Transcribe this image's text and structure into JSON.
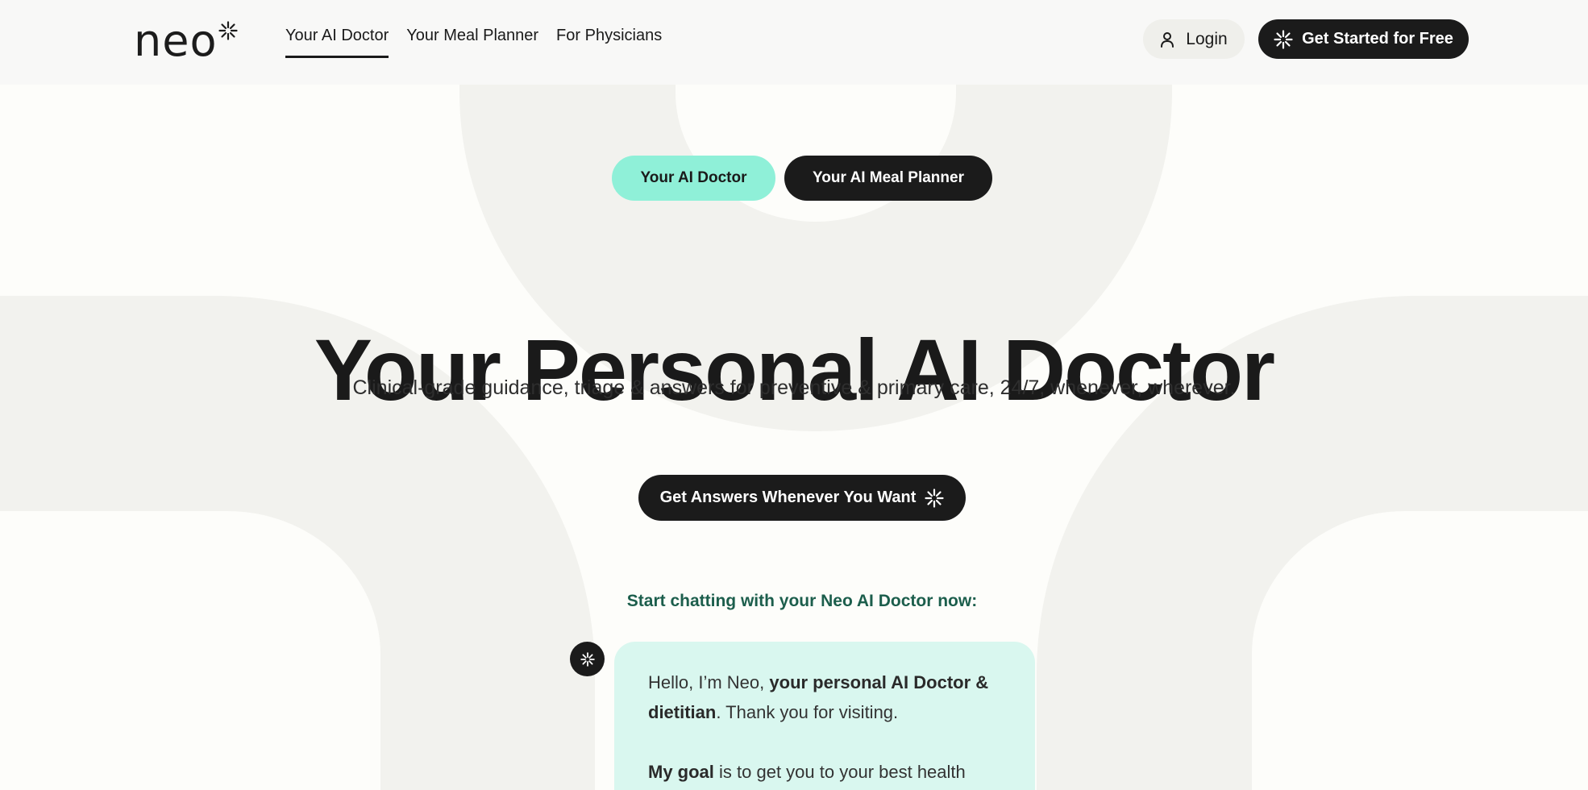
{
  "brand": {
    "logo_text": "neo",
    "colors": {
      "dark": "#1b1b1b",
      "mint": "#8ff0d8",
      "mint_light": "#d9f7ef",
      "green_text": "#1c5e4c",
      "bg_shape": "#f2f2ee"
    }
  },
  "nav": {
    "items": [
      {
        "label": "Your AI Doctor",
        "active": true
      },
      {
        "label": "Your Meal Planner",
        "active": false
      },
      {
        "label": "For Physicians",
        "active": false
      }
    ]
  },
  "header": {
    "login_label": "Login",
    "login_icon": "user-icon",
    "cta_label": "Get Started for Free",
    "cta_icon": "sparkle-icon"
  },
  "toggle": {
    "doctor_label": "Your AI Doctor",
    "meal_label": "Your AI Meal Planner"
  },
  "hero": {
    "title": "Your Personal AI Doctor",
    "subtitle": "Clinical-grade guidance, triage & answers for preventive & primary care, 24/7, whenever, wherever.",
    "cta_label": "Get Answers Whenever You Want",
    "cta_icon": "sparkle-icon"
  },
  "chat": {
    "prompt": "Start chatting with your Neo AI Doctor now:",
    "avatar_icon": "sparkle-icon",
    "message": {
      "p1_intro": "Hello, I’m Neo, ",
      "p1_bold": "your personal AI Doctor & dietitian",
      "p1_end": ". Thank you for visiting.",
      "p2_bold": "My goal",
      "p2_rest": " is to get you to your best health"
    }
  }
}
